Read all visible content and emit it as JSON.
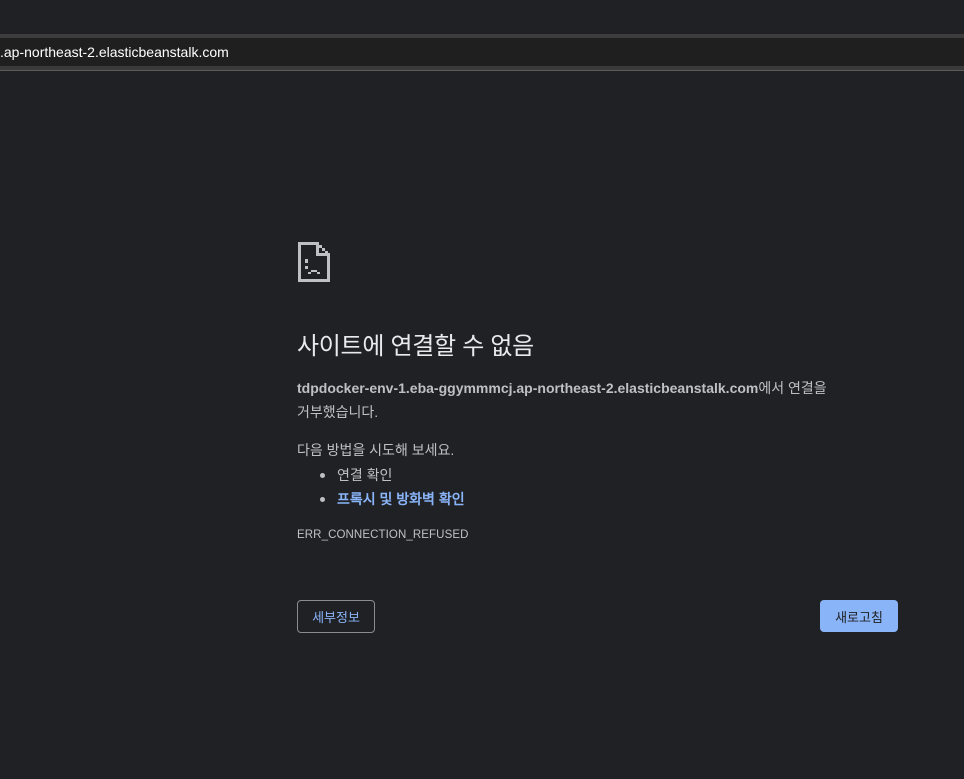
{
  "browser": {
    "url": ".ap-northeast-2.elasticbeanstalk.com"
  },
  "error_page": {
    "icon": "sad-page-icon",
    "title": "사이트에 연결할 수 없음",
    "host": "tdpdocker-env-1.eba-ggymmmcj.ap-northeast-2.elasticbeanstalk.com",
    "host_suffix_line1": "에서 연결을",
    "host_suffix_line2": "거부했습니다.",
    "try_heading": "다음 방법을 시도해 보세요.",
    "suggestions": [
      "연결 확인",
      "프록시 및 방화벽 확인"
    ],
    "error_code": "ERR_CONNECTION_REFUSED",
    "details_button": "세부정보",
    "reload_button": "새로고침"
  },
  "colors": {
    "background": "#202124",
    "text": "#bdc1c6",
    "title": "#e8eaed",
    "link": "#8ab4f8",
    "primary_button": "#8ab4f8"
  }
}
